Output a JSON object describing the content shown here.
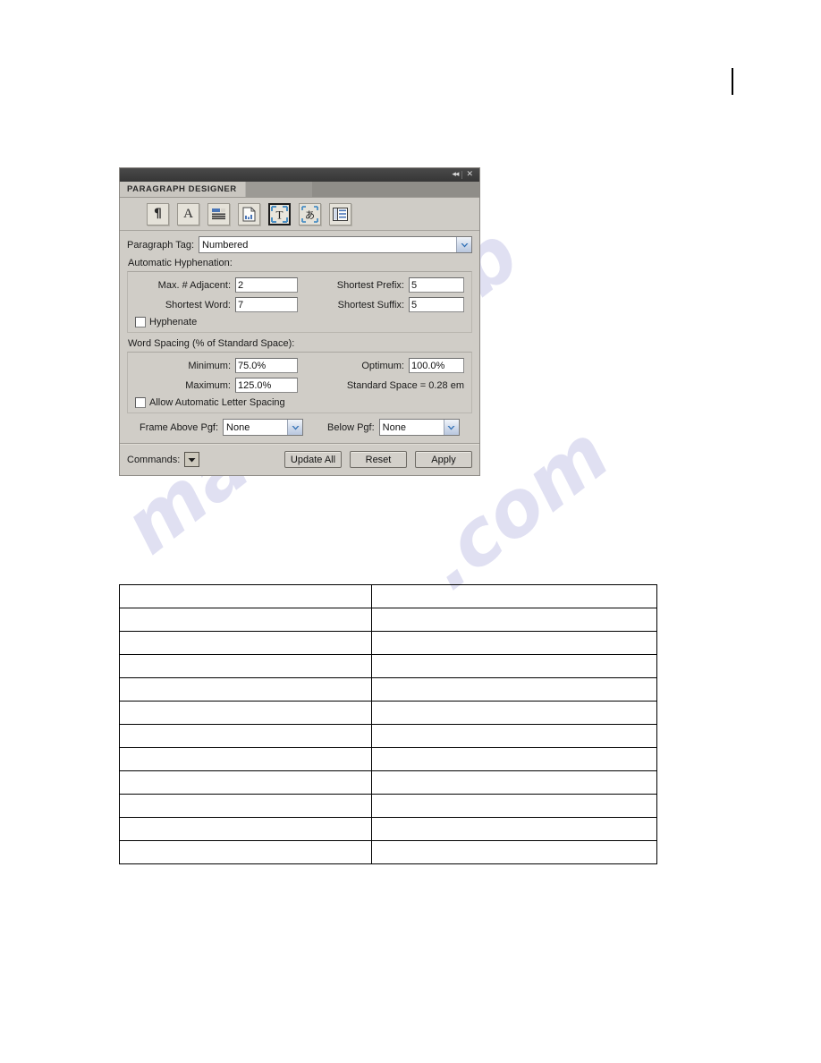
{
  "page": {
    "watermark_lines": [
      "manualslib",
      ".com"
    ],
    "crop_mark": "vertical-rule"
  },
  "panel": {
    "titlebar": {
      "collapse_icon": "◂◂",
      "close_icon": "✕"
    },
    "tab_label": "PARAGRAPH DESIGNER",
    "toolbar": [
      {
        "name": "basic-properties",
        "glyph": "¶",
        "selected": false
      },
      {
        "name": "default-font",
        "glyph": "A",
        "selected": false
      },
      {
        "name": "pagination",
        "glyph": "pagination-lines",
        "selected": false
      },
      {
        "name": "numbering",
        "glyph": "page-number",
        "selected": false
      },
      {
        "name": "advanced",
        "glyph": "T",
        "selected": true
      },
      {
        "name": "asian-typography",
        "glyph": "あ",
        "selected": false
      },
      {
        "name": "table-cell",
        "glyph": "table-cell-lines",
        "selected": false
      }
    ],
    "paragraph_tag": {
      "label": "Paragraph Tag:",
      "value": "Numbered"
    },
    "hyphenation": {
      "group_label": "Automatic Hyphenation:",
      "max_adjacent_label": "Max. # Adjacent:",
      "max_adjacent_value": "2",
      "shortest_prefix_label": "Shortest Prefix:",
      "shortest_prefix_value": "5",
      "shortest_word_label": "Shortest Word:",
      "shortest_word_value": "7",
      "shortest_suffix_label": "Shortest Suffix:",
      "shortest_suffix_value": "5",
      "hyphenate_label": "Hyphenate",
      "hyphenate_checked": false
    },
    "word_spacing": {
      "group_label": "Word Spacing (% of Standard Space):",
      "minimum_label": "Minimum:",
      "minimum_value": "75.0%",
      "optimum_label": "Optimum:",
      "optimum_value": "100.0%",
      "maximum_label": "Maximum:",
      "maximum_value": "125.0%",
      "standard_space_text": "Standard Space = 0.28 em",
      "letter_spacing_label": "Allow Automatic Letter Spacing",
      "letter_spacing_checked": false
    },
    "frames": {
      "above_label": "Frame Above Pgf:",
      "above_value": "None",
      "below_label": "Below Pgf:",
      "below_value": "None"
    },
    "footer": {
      "commands_label": "Commands:",
      "update_all_label": "Update All",
      "reset_label": "Reset",
      "apply_label": "Apply"
    }
  },
  "doc_table": {
    "rows": 12,
    "columns": 2,
    "cells": [
      [
        "",
        ""
      ],
      [
        "",
        ""
      ],
      [
        "",
        ""
      ],
      [
        "",
        ""
      ],
      [
        "",
        ""
      ],
      [
        "",
        ""
      ],
      [
        "",
        ""
      ],
      [
        "",
        ""
      ],
      [
        "",
        ""
      ],
      [
        "",
        ""
      ],
      [
        "",
        ""
      ],
      [
        "",
        ""
      ]
    ]
  }
}
